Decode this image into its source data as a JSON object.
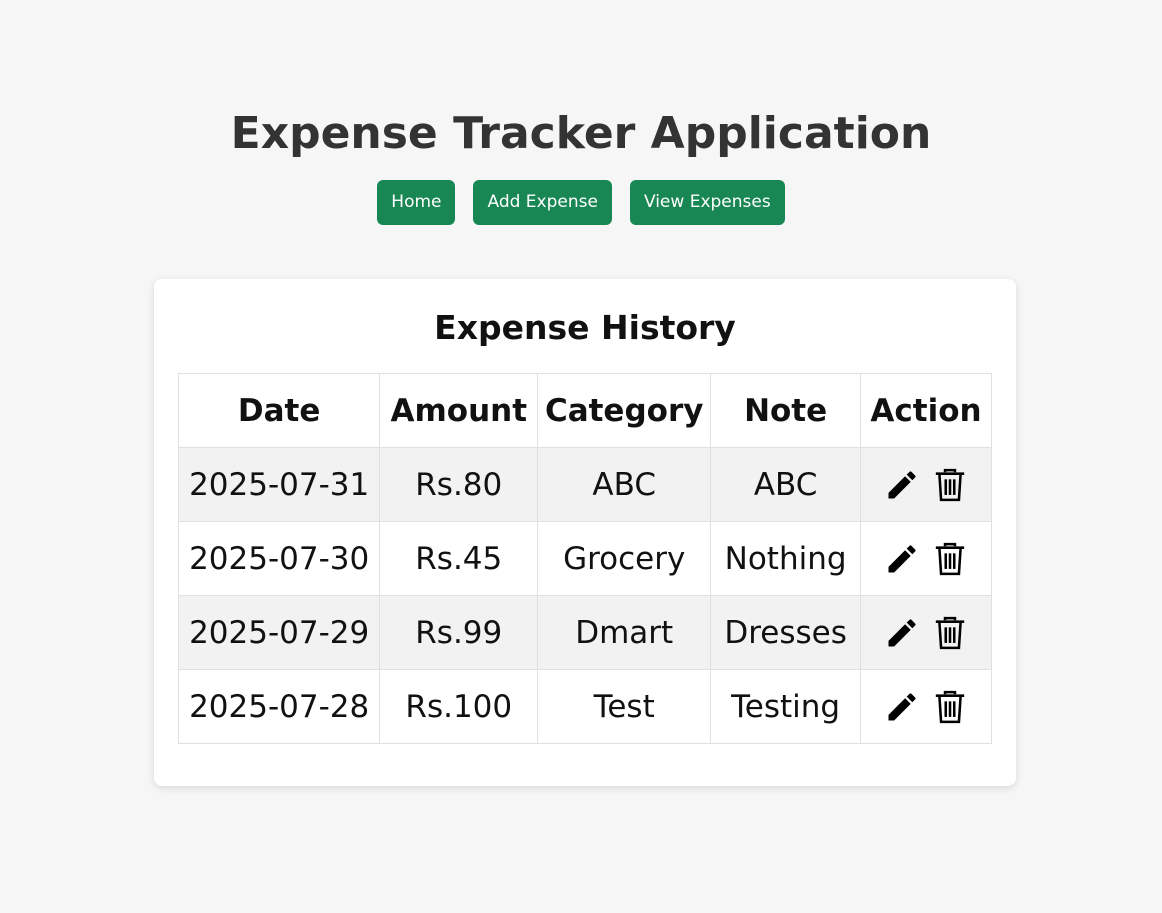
{
  "header": {
    "title": "Expense Tracker Application"
  },
  "nav": {
    "home": "Home",
    "add_expense": "Add Expense",
    "view_expenses": "View Expenses"
  },
  "history": {
    "title": "Expense History",
    "columns": [
      "Date",
      "Amount",
      "Category",
      "Note",
      "Action"
    ],
    "rows": [
      {
        "date": "2025-07-31",
        "amount": "Rs.80",
        "category": "ABC",
        "note": "ABC"
      },
      {
        "date": "2025-07-30",
        "amount": "Rs.45",
        "category": "Grocery",
        "note": "Nothing"
      },
      {
        "date": "2025-07-29",
        "amount": "Rs.99",
        "category": "Dmart",
        "note": "Dresses"
      },
      {
        "date": "2025-07-28",
        "amount": "Rs.100",
        "category": "Test",
        "note": "Testing"
      }
    ],
    "actions": {
      "edit_icon": "pencil-icon",
      "delete_icon": "trash-icon"
    }
  },
  "colors": {
    "accent": "#198754",
    "background": "#f6f6f6"
  }
}
